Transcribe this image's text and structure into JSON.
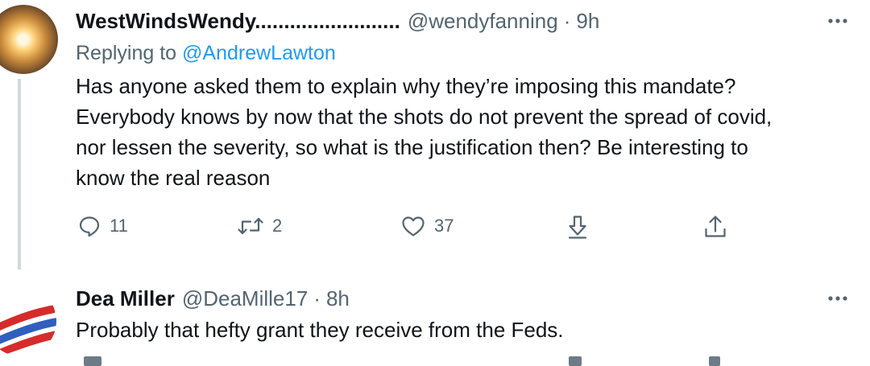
{
  "tweets": [
    {
      "name": "WestWindsWendy.........................",
      "handle": "@wendyfanning",
      "separator": "·",
      "time": "9h",
      "replying_prefix": "Replying to",
      "replying_handle": "@AndrewLawton",
      "text_lines": [
        "Has anyone asked them to explain why they’re imposing this mandate?",
        "Everybody knows by now that the shots do not prevent the spread of covid,",
        "nor lessen the severity, so what is the justification then? Be interesting to",
        "know the real reason"
      ],
      "counts": {
        "replies": "11",
        "retweets": "2",
        "likes": "37"
      }
    },
    {
      "name": "Dea Miller",
      "handle": "@DeaMille17",
      "separator": "·",
      "time": "8h",
      "text_lines": [
        "Probably that hefty grant they receive from the Feds."
      ]
    }
  ],
  "icons": {
    "more": "more-dots-icon",
    "reply": "reply-bubble-icon",
    "retweet": "retweet-icon",
    "like": "heart-icon",
    "download": "download-arrow-icon",
    "share": "share-icon"
  },
  "colors": {
    "text": "#0f1419",
    "secondary": "#536471",
    "link": "#1d9bf0",
    "thread_line": "#cfd9de"
  }
}
